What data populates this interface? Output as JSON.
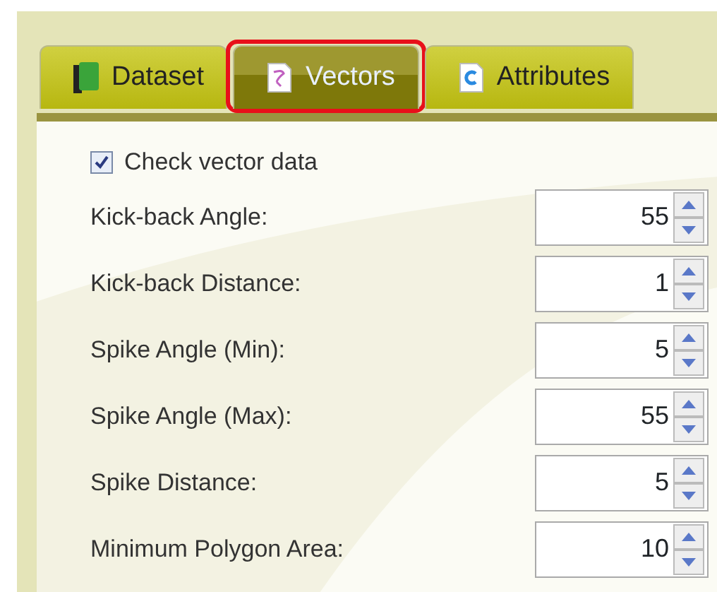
{
  "tabs": [
    {
      "label": "Dataset",
      "kind": "book",
      "selected": false,
      "highlighted": false
    },
    {
      "label": "Vectors",
      "kind": "document",
      "selected": true,
      "highlighted": true
    },
    {
      "label": "Attributes",
      "kind": "letter",
      "selected": false,
      "highlighted": false
    }
  ],
  "check": {
    "label": "Check vector data",
    "checked": true
  },
  "fields": [
    {
      "label": "Kick-back Angle:",
      "value": "55"
    },
    {
      "label": "Kick-back Distance:",
      "value": "1"
    },
    {
      "label": "Spike Angle (Min):",
      "value": "5"
    },
    {
      "label": "Spike Angle (Max):",
      "value": "55"
    },
    {
      "label": "Spike Distance:",
      "value": "5"
    },
    {
      "label": "Minimum Polygon Area:",
      "value": "10"
    }
  ]
}
